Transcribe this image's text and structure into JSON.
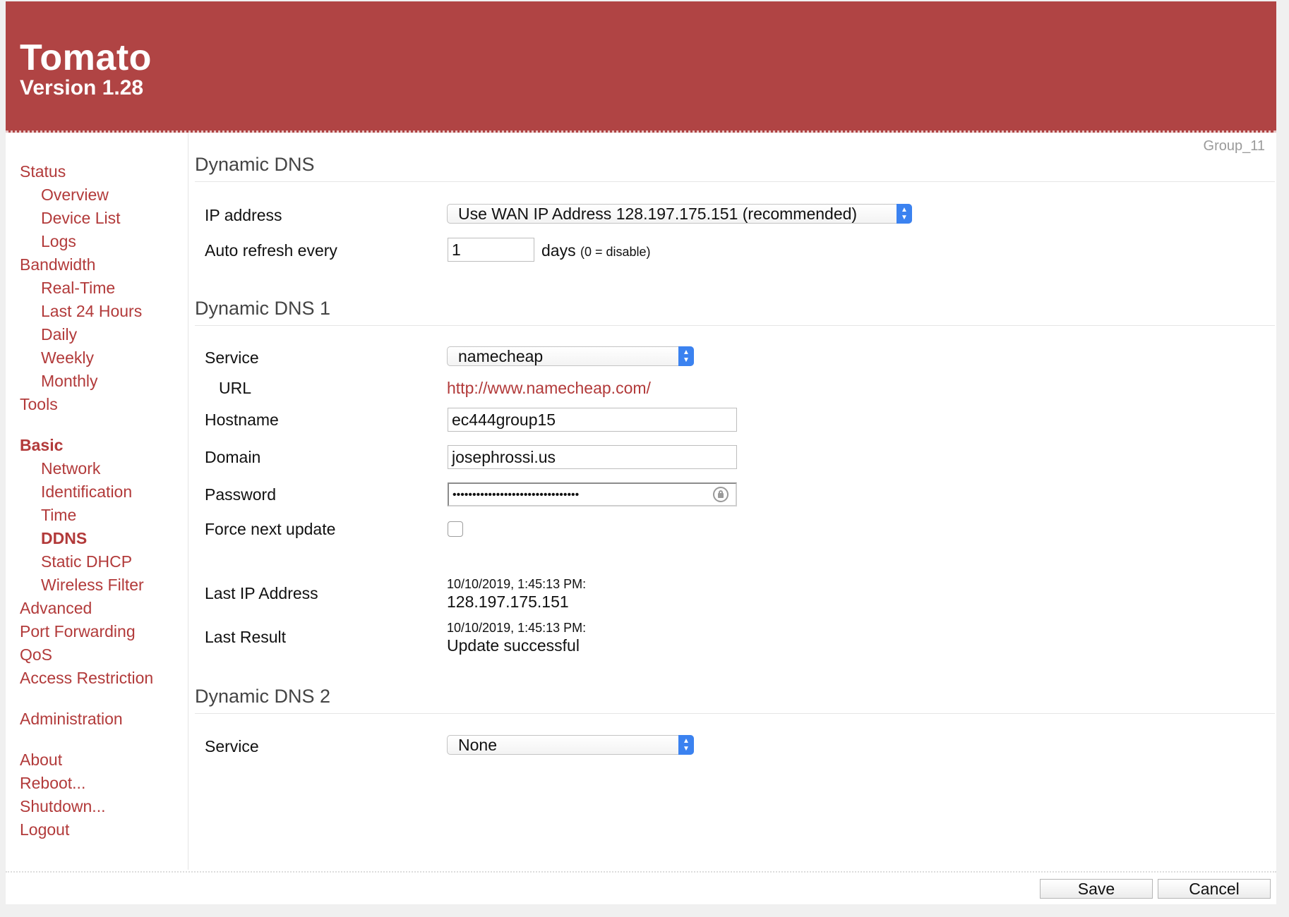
{
  "header": {
    "title": "Tomato",
    "version": "Version 1.28"
  },
  "group_label": "Group_11",
  "sidebar": {
    "status": "Status",
    "overview": "Overview",
    "device_list": "Device List",
    "logs": "Logs",
    "bandwidth": "Bandwidth",
    "real_time": "Real-Time",
    "last_24_hours": "Last 24 Hours",
    "daily": "Daily",
    "weekly": "Weekly",
    "monthly": "Monthly",
    "tools": "Tools",
    "basic": "Basic",
    "network": "Network",
    "identification": "Identification",
    "time": "Time",
    "ddns": "DDNS",
    "static_dhcp": "Static DHCP",
    "wireless_filter": "Wireless Filter",
    "advanced": "Advanced",
    "port_forwarding": "Port Forwarding",
    "qos": "QoS",
    "access_restriction": "Access Restriction",
    "administration": "Administration",
    "about": "About",
    "reboot": "Reboot...",
    "shutdown": "Shutdown...",
    "logout": "Logout"
  },
  "ddns": {
    "title": "Dynamic DNS",
    "ip_address_label": "IP address",
    "ip_address_value": "Use WAN IP Address 128.197.175.151 (recommended)",
    "auto_refresh_label": "Auto refresh every",
    "auto_refresh_value": "1",
    "auto_refresh_unit": "days",
    "auto_refresh_hint": "(0 = disable)"
  },
  "ddns1": {
    "title": "Dynamic DNS 1",
    "service_label": "Service",
    "service_value": "namecheap",
    "url_label": "URL",
    "url_value": "http://www.namecheap.com/",
    "hostname_label": "Hostname",
    "hostname_value": "ec444group15",
    "domain_label": "Domain",
    "domain_value": "josephrossi.us",
    "password_label": "Password",
    "password_value": "••••••••••••••••••••••••••••••••",
    "force_label": "Force next update",
    "force_checked": false,
    "last_ip_label": "Last IP Address",
    "last_ip_time": "10/10/2019, 1:45:13 PM:",
    "last_ip_value": "128.197.175.151",
    "last_result_label": "Last Result",
    "last_result_time": "10/10/2019, 1:45:13 PM:",
    "last_result_value": "Update successful"
  },
  "ddns2": {
    "title": "Dynamic DNS 2",
    "service_label": "Service",
    "service_value": "None"
  },
  "footer": {
    "save": "Save",
    "cancel": "Cancel"
  },
  "icons": {
    "select_arrow": "updown-chevron-icon",
    "password_key": "key-lock-icon"
  },
  "colors": {
    "header": "#b04444",
    "link": "#b23a3a",
    "select_arrow": "#3b82f0"
  }
}
